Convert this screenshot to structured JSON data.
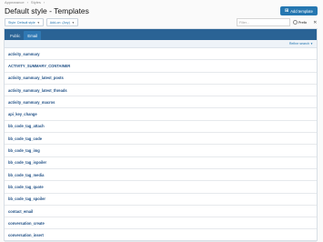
{
  "breadcrumb": [
    "Appearance",
    "Styles"
  ],
  "page_title": "Default style - Templates",
  "add_button": {
    "label": "Add template"
  },
  "filters": {
    "style_label": "Style: Default style",
    "addon_label": "Add-on: (Any)"
  },
  "search": {
    "placeholder": "Filter...",
    "prefix_label": "Prefix"
  },
  "tabs": [
    {
      "label": "Public",
      "active": false
    },
    {
      "label": "Email",
      "active": true
    }
  ],
  "refine_label": "Refine search",
  "templates": [
    "activity_summary",
    "ACTIVITY_SUMMARY_CONTAINER",
    "activity_summary_latest_posts",
    "activity_summary_latest_threads",
    "activity_summary_macros",
    "api_key_change",
    "bb_code_tag_attach",
    "bb_code_tag_code",
    "bb_code_tag_img",
    "bb_code_tag_ispoiler",
    "bb_code_tag_media",
    "bb_code_tag_quote",
    "bb_code_tag_spoiler",
    "contact_email",
    "conversation_create",
    "conversation_insert"
  ]
}
